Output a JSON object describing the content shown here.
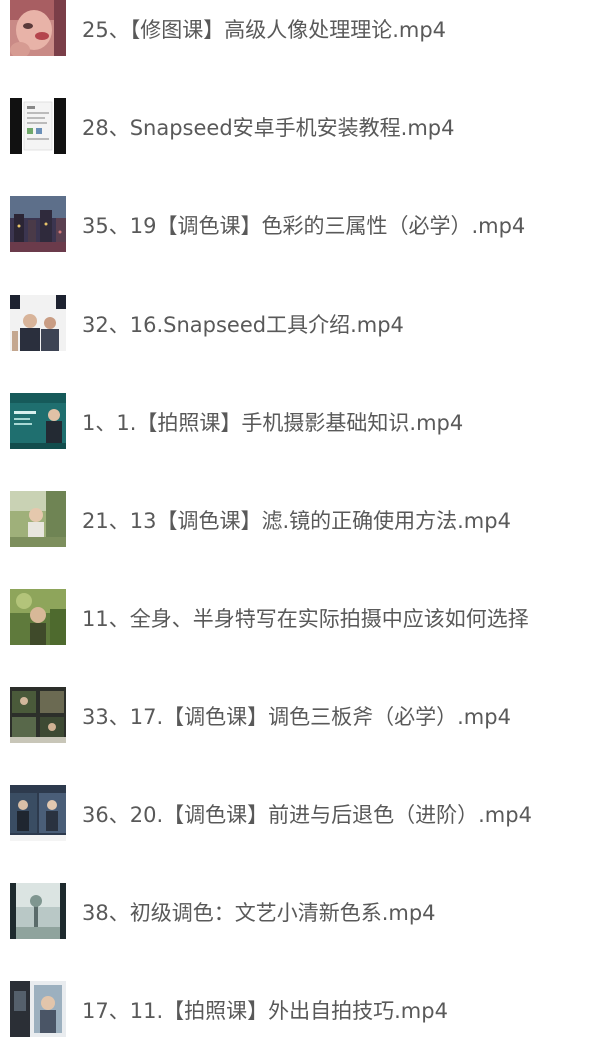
{
  "files": [
    {
      "name": "25、【修图课】高级人像处理理论.mp4",
      "thumbnail": "portrait-closeup-thumbnail"
    },
    {
      "name": "28、Snapseed安卓手机安装教程.mp4",
      "thumbnail": "phone-screen-thumbnail"
    },
    {
      "name": "35、19【调色课】色彩的三属性（必学）.mp4",
      "thumbnail": "city-scene-thumbnail"
    },
    {
      "name": "32、16.Snapseed工具介绍.mp4",
      "thumbnail": "people-thumbnail"
    },
    {
      "name": "1、1.【拍照课】手机摄影基础知识.mp4",
      "thumbnail": "teal-slide-thumbnail"
    },
    {
      "name": "21、13【调色课】滤.镜的正确使用方法.mp4",
      "thumbnail": "outdoor-portrait-thumbnail"
    },
    {
      "name": "11、全身、半身特写在实际拍摄中应该如何选择",
      "thumbnail": "nature-portrait-thumbnail"
    },
    {
      "name": "33、17.【调色课】调色三板斧（必学）.mp4",
      "thumbnail": "editing-collage-thumbnail"
    },
    {
      "name": "36、20.【调色课】前进与后退色（进阶）.mp4",
      "thumbnail": "comparison-thumbnail"
    },
    {
      "name": "38、初级调色：文艺小清新色系.mp4",
      "thumbnail": "fresh-scenery-thumbnail"
    },
    {
      "name": "17、11.【拍照课】外出自拍技巧.mp4",
      "thumbnail": "selfie-thumbnail"
    }
  ]
}
